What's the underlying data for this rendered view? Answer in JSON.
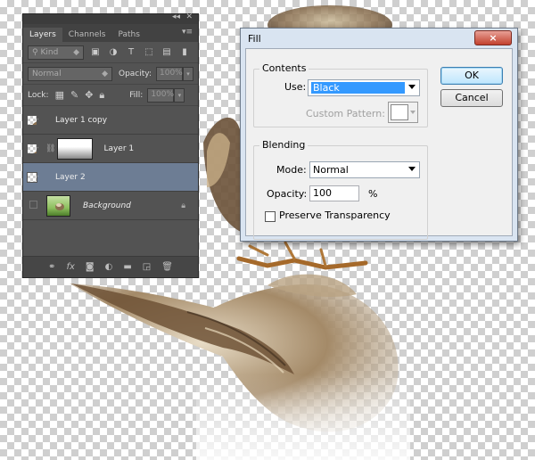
{
  "layers_panel": {
    "tabs": [
      "Layers",
      "Channels",
      "Paths"
    ],
    "active_tab": "Layers",
    "filter_kind": "Kind",
    "blend_mode": "Normal",
    "opacity_label": "Opacity:",
    "opacity_value": "100%",
    "lock_label": "Lock:",
    "fill_label": "Fill:",
    "fill_value": "100%",
    "layers": [
      {
        "name": "Layer 1 copy",
        "visible": true,
        "selected": false,
        "thumb": "bird"
      },
      {
        "name": "Layer 1",
        "visible": true,
        "selected": false,
        "thumb": "bird",
        "has_mask": true
      },
      {
        "name": "Layer 2",
        "visible": true,
        "selected": true,
        "thumb": "transparent"
      },
      {
        "name": "Background",
        "visible": false,
        "selected": false,
        "thumb": "background",
        "locked": true
      }
    ],
    "bottom_icons": [
      "link-icon",
      "fx-icon",
      "add-mask-icon",
      "adjustment-icon",
      "group-folder-icon",
      "new-layer-icon",
      "trash-icon"
    ]
  },
  "fill_dialog": {
    "title": "Fill",
    "close_label": "×",
    "contents_label": "Contents",
    "use_label": "Use:",
    "use_value": "Black",
    "custom_pattern_label": "Custom Pattern:",
    "blending_label": "Blending",
    "mode_label": "Mode:",
    "mode_value": "Normal",
    "opacity_label": "Opacity:",
    "opacity_value": "100",
    "opacity_unit": "%",
    "preserve_label": "Preserve Transparency",
    "preserve_checked": false,
    "ok_label": "OK",
    "cancel_label": "Cancel"
  }
}
